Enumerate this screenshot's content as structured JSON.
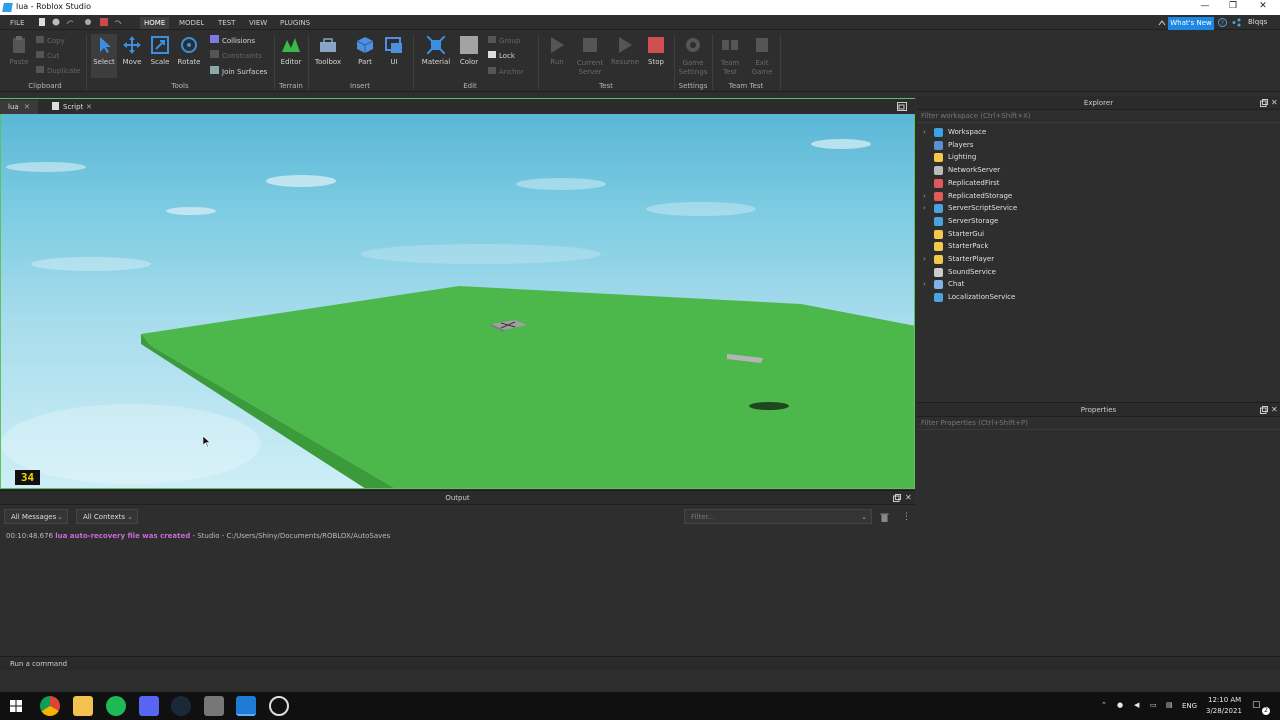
{
  "window": {
    "title": "lua - Roblox Studio",
    "minimize": "—",
    "maximize": "❐",
    "close": "✕"
  },
  "menu": {
    "tabs": [
      "FILE",
      "HOME",
      "MODEL",
      "TEST",
      "VIEW",
      "PLUGINS"
    ],
    "active": "HOME",
    "whats_new": "What's New",
    "user": "Blqqs"
  },
  "ribbon": {
    "clipboard": {
      "paste": "Paste",
      "copy": "Copy",
      "cut": "Cut",
      "duplicate": "Duplicate",
      "group": "Clipboard"
    },
    "tools": {
      "select": "Select",
      "move": "Move",
      "scale": "Scale",
      "rotate": "Rotate",
      "collisions": "Collisions",
      "constraints": "Constraints",
      "join_surfaces": "Join Surfaces",
      "group": "Tools"
    },
    "terrain": {
      "editor": "Editor",
      "group": "Terrain"
    },
    "insert": {
      "toolbox": "Toolbox",
      "part": "Part",
      "ui": "UI",
      "group": "Insert"
    },
    "edit": {
      "material": "Material",
      "color": "Color",
      "group_btn": "Group",
      "lock": "Lock",
      "anchor": "Anchor",
      "group": "Edit"
    },
    "test": {
      "run": "Run",
      "current_server_1": "Current",
      "current_server_2": "Server",
      "resume": "Resume",
      "stop": "Stop",
      "group": "Test"
    },
    "settings": {
      "game_settings_1": "Game",
      "game_settings_2": "Settings",
      "group": "Settings"
    },
    "team_test": {
      "team_test_1": "Team",
      "team_test_2": "Test",
      "exit_game_1": "Exit",
      "exit_game_2": "Game",
      "group": "Team Test"
    }
  },
  "doc_tabs": [
    {
      "label": "lua",
      "close": "✕"
    },
    {
      "label": "Script",
      "close": "✕"
    }
  ],
  "viewport": {
    "fps_badge": "34"
  },
  "output": {
    "title": "Output",
    "filter_messages": "All Messages",
    "filter_contexts": "All Contexts",
    "filter_placeholder": "Filter...",
    "log": [
      {
        "time": "00:10:48.676",
        "highlight": "lua auto-recovery file was created",
        "rest": " - Studio - C:/Users/Shiny/Documents/ROBLOX/AutoSaves"
      }
    ]
  },
  "explorer": {
    "title": "Explorer",
    "filter_placeholder": "Filter workspace (Ctrl+Shift+X)",
    "items": [
      {
        "label": "Workspace",
        "expandable": true,
        "color": "#3ba3e8"
      },
      {
        "label": "Players",
        "expandable": false,
        "color": "#5a8fd6"
      },
      {
        "label": "Lighting",
        "expandable": false,
        "color": "#f2c94c"
      },
      {
        "label": "NetworkServer",
        "expandable": false,
        "color": "#bbbbbb"
      },
      {
        "label": "ReplicatedFirst",
        "expandable": false,
        "color": "#e05a5a"
      },
      {
        "label": "ReplicatedStorage",
        "expandable": true,
        "color": "#e05a5a"
      },
      {
        "label": "ServerScriptService",
        "expandable": true,
        "color": "#4aa3df"
      },
      {
        "label": "ServerStorage",
        "expandable": false,
        "color": "#4aa3df"
      },
      {
        "label": "StarterGui",
        "expandable": false,
        "color": "#f2c94c"
      },
      {
        "label": "StarterPack",
        "expandable": false,
        "color": "#f2c94c"
      },
      {
        "label": "StarterPlayer",
        "expandable": true,
        "color": "#f2c94c"
      },
      {
        "label": "SoundService",
        "expandable": false,
        "color": "#cccccc"
      },
      {
        "label": "Chat",
        "expandable": true,
        "color": "#7fb3e6"
      },
      {
        "label": "LocalizationService",
        "expandable": false,
        "color": "#4aa3df"
      }
    ]
  },
  "properties": {
    "title": "Properties",
    "filter_placeholder": "Filter Properties (Ctrl+Shift+P)"
  },
  "command_bar": {
    "placeholder": "Run a command"
  },
  "taskbar": {
    "time": "12:10 AM",
    "date": "3/28/2021",
    "lang": "ENG",
    "notifications": "2"
  }
}
